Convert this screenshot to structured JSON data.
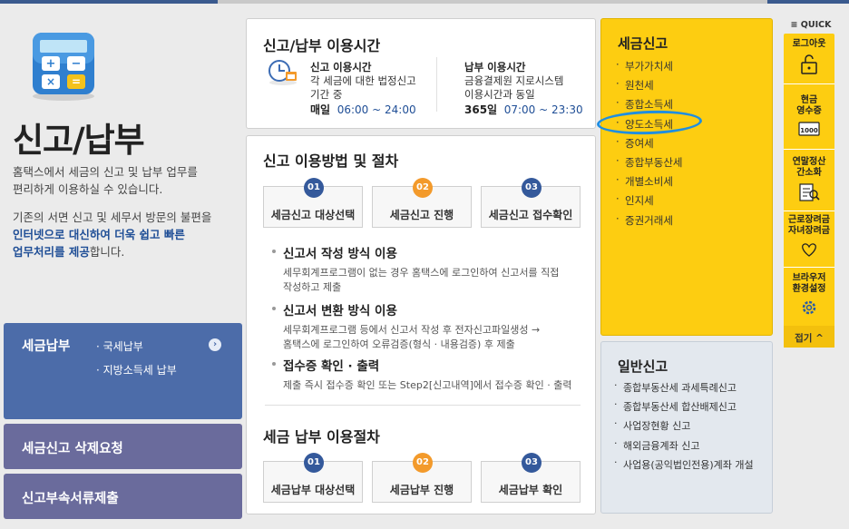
{
  "page": {
    "title": "신고/납부",
    "intro_line1": "홈택스에서 세금의 신고 및 납부 업무를",
    "intro_line2": "편리하게 이용하실 수 있습니다.",
    "intro2_line1": "기존의 서면 신고 및 세무서 방문의 불편을",
    "intro2_highlight1": "인터넷으로 대신하여 더욱 쉽고 빠른",
    "intro2_highlight2": "업무처리를 제공",
    "intro2_suffix": "합니다."
  },
  "sidebar": {
    "main_label": "세금납부",
    "sub_items": [
      "국세납부",
      "지방소득세 납부"
    ],
    "buttons": [
      "세금신고 삭제요청",
      "신고부속서류제출"
    ]
  },
  "hours": {
    "title": "신고/납부 이용시간",
    "filing": {
      "label": "신고 이용시간",
      "desc1": "각 세금에 대한 법정신고",
      "desc2": "기간 중",
      "day": "매일",
      "time": "06:00 ~ 24:00"
    },
    "payment": {
      "label": "납부 이용시간",
      "desc1": "금융결제원 지로시스템",
      "desc2": "이용시간과 동일",
      "day": "365일",
      "time": "07:00 ~ 23:30"
    }
  },
  "procedure": {
    "title": "신고 이용방법 및 절차",
    "steps": [
      {
        "num": "01",
        "label": "세금신고 대상선택"
      },
      {
        "num": "02",
        "label": "세금신고 진행"
      },
      {
        "num": "03",
        "label": "세금신고 접수확인"
      }
    ],
    "methods": [
      {
        "head": "신고서 작성 방식 이용",
        "desc1": "세무회계프로그램이 없는 경우 홈택스에 로그인하여 신고서를 직접",
        "desc2": "작성하고 제출"
      },
      {
        "head": "신고서 변환 방식 이용",
        "desc1": "세무회계프로그램 등에서 신고서 작성 후 전자신고파일생성 →",
        "desc2": "홈택스에 로그인하여 오류검증(형식 · 내용검증) 후 제출"
      },
      {
        "head": "접수증 확인 · 출력",
        "desc1": "제출 즉시 접수증 확인 또는 Step2[신고내역]에서 접수증 확인 · 출력",
        "desc2": ""
      }
    ],
    "payment_title": "세금 납부 이용절차",
    "payment_steps": [
      {
        "num": "01",
        "label": "세금납부 대상선택"
      },
      {
        "num": "02",
        "label": "세금납부 진행"
      },
      {
        "num": "03",
        "label": "세금납부 확인"
      }
    ]
  },
  "tax_panel": {
    "title": "세금신고",
    "items": [
      "부가가치세",
      "원천세",
      "종합소득세",
      "양도소득세",
      "증여세",
      "종합부동산세",
      "개별소비세",
      "인지세",
      "증권거래세"
    ]
  },
  "general_panel": {
    "title": "일반신고",
    "items": [
      "종합부동산세 과세특례신고",
      "종합부동산세 합산배제신고",
      "사업장현황 신고",
      "해외금융계좌 신고",
      "사업용(공익법인전용)계좌 개설"
    ]
  },
  "quick": {
    "header": "QUICK",
    "items": [
      "로그아웃",
      "현금\n영수증",
      "연말정산\n간소화",
      "근로장려금\n자녀장려금",
      "브라우저\n환경설정"
    ],
    "close_label": "접기 ^"
  },
  "colors": {
    "accent_yellow": "#fdcd11",
    "nav_blue": "#4c6ca9",
    "nav_purple": "#6a6b9c",
    "step_blue": "#34599b",
    "step_orange": "#f39a2b",
    "annotation": "#1f8ee0"
  }
}
